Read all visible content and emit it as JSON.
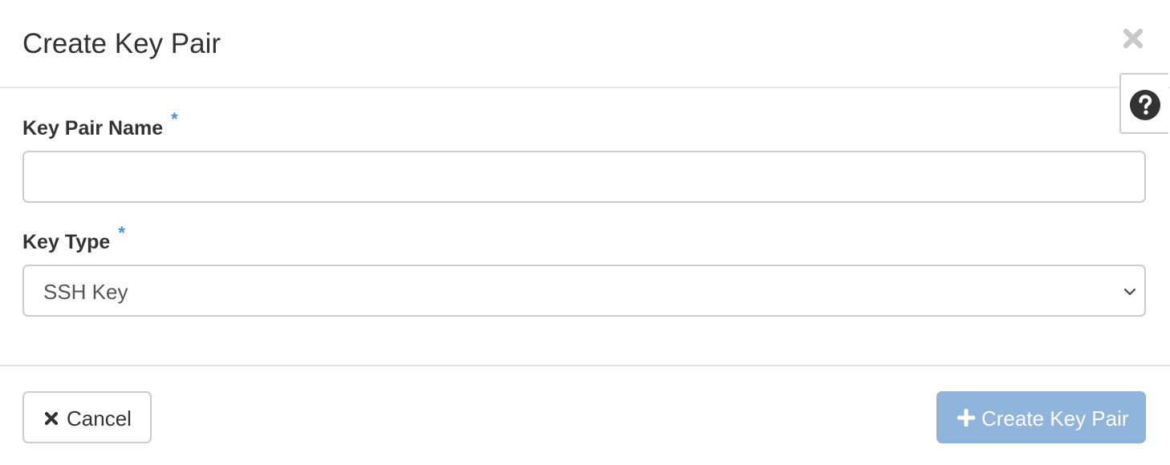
{
  "dialog": {
    "title": "Create Key Pair",
    "close_icon": "close-icon",
    "help_icon": "question-circle-icon"
  },
  "form": {
    "key_pair_name": {
      "label": "Key Pair Name",
      "required_marker": "*",
      "value": "",
      "placeholder": ""
    },
    "key_type": {
      "label": "Key Type",
      "required_marker": "*",
      "selected": "SSH Key",
      "chevron_icon": "chevron-down-icon"
    }
  },
  "footer": {
    "cancel_label": "Cancel",
    "cancel_icon": "times-icon",
    "submit_label": "Create Key Pair",
    "submit_icon": "plus-icon",
    "submit_disabled": true
  },
  "colors": {
    "primary_disabled": "#8fb5dd",
    "required_marker": "#4a90e2",
    "border": "#cccccc",
    "divider": "#e5e5e5"
  }
}
